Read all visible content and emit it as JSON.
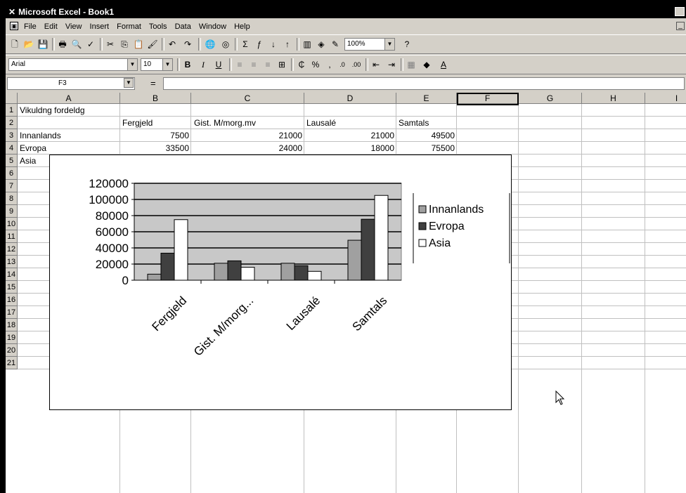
{
  "window": {
    "title": "Microsoft Excel - Book1"
  },
  "menu": [
    "File",
    "Edit",
    "View",
    "Insert",
    "Format",
    "Tools",
    "Data",
    "Window",
    "Help"
  ],
  "toolbar": {
    "zoom": "100%",
    "font": "Arial",
    "font_size": "10"
  },
  "formula_bar": {
    "name_box": "F3",
    "equals": "=",
    "value": ""
  },
  "columns": [
    "A",
    "B",
    "C",
    "D",
    "E",
    "F",
    "G",
    "H",
    "I"
  ],
  "rows": [
    "1",
    "2",
    "3",
    "4",
    "5",
    "6",
    "7",
    "8",
    "9",
    "10",
    "11",
    "12",
    "13",
    "14",
    "15",
    "16",
    "17",
    "18",
    "19",
    "20",
    "21"
  ],
  "sheet": {
    "a1": "Vikuldng fordeldg",
    "headers": [
      "Fergjeld",
      "Gist. M/morg.mv",
      "Lausalé",
      "Samtals"
    ],
    "rows": [
      {
        "label": "Innanlands",
        "values": [
          "7500",
          "21000",
          "21000",
          "49500"
        ]
      },
      {
        "label": "Evropa",
        "values": [
          "33500",
          "24000",
          "18000",
          "75500"
        ]
      },
      {
        "label": "Asia",
        "values": [
          "75000",
          "10000",
          "13000",
          "105000"
        ]
      }
    ]
  },
  "chart_data": {
    "type": "bar",
    "categories": [
      "Fergjeld",
      "Gist. M/morg...",
      "Lausalé",
      "Samtals"
    ],
    "series": [
      {
        "name": "Innanlands",
        "values": [
          7500,
          21000,
          21000,
          49500
        ]
      },
      {
        "name": "Evropa",
        "values": [
          33500,
          24000,
          18000,
          75500
        ]
      },
      {
        "name": "Asia",
        "values": [
          75000,
          16000,
          11000,
          105000
        ]
      }
    ],
    "yticks": [
      "0",
      "20000",
      "40000",
      "60000",
      "80000",
      "100000",
      "120000"
    ],
    "ylim": [
      0,
      120000
    ],
    "colors": [
      "#a0a0a0",
      "#404040",
      "#ffffff"
    ],
    "plot_bg": "#c8c8c8",
    "legend": "right",
    "grid": true
  }
}
